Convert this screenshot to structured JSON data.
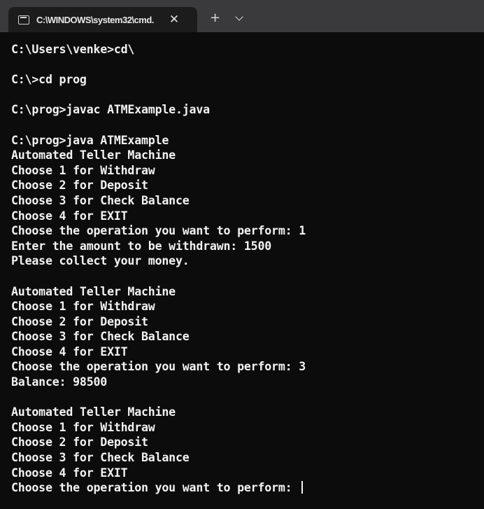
{
  "tab": {
    "title": "C:\\WINDOWS\\system32\\cmd.",
    "close_glyph": "✕",
    "new_tab_glyph": "+"
  },
  "console": {
    "lines": [
      "C:\\Users\\venke>cd\\",
      "",
      "C:\\>cd prog",
      "",
      "C:\\prog>javac ATMExample.java",
      "",
      "C:\\prog>java ATMExample",
      "Automated Teller Machine",
      "Choose 1 for Withdraw",
      "Choose 2 for Deposit",
      "Choose 3 for Check Balance",
      "Choose 4 for EXIT",
      "Choose the operation you want to perform: 1",
      "Enter the amount to be withdrawn: 1500",
      "Please collect your money.",
      "",
      "Automated Teller Machine",
      "Choose 1 for Withdraw",
      "Choose 2 for Deposit",
      "Choose 3 for Check Balance",
      "Choose 4 for EXIT",
      "Choose the operation you want to perform: 3",
      "Balance: 98500",
      "",
      "Automated Teller Machine",
      "Choose 1 for Withdraw",
      "Choose 2 for Deposit",
      "Choose 3 for Check Balance",
      "Choose 4 for EXIT",
      "Choose the operation you want to perform: "
    ]
  }
}
